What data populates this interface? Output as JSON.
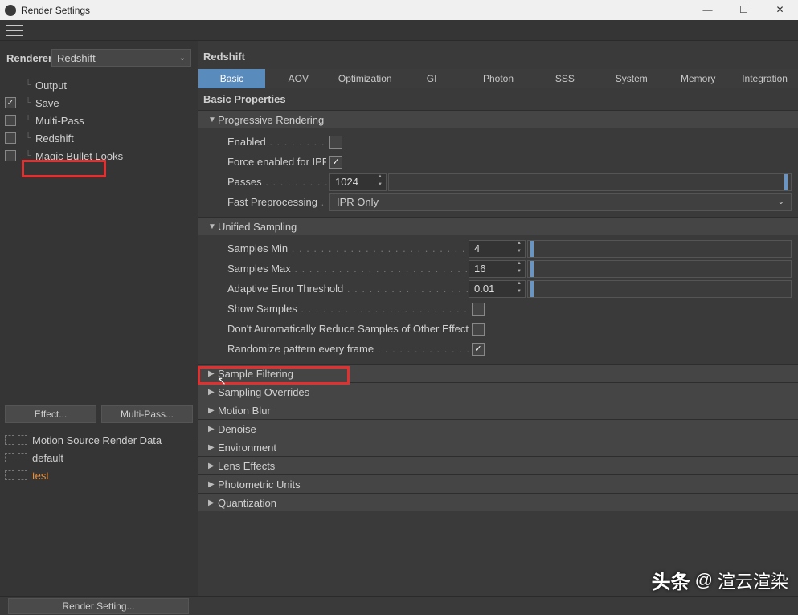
{
  "window": {
    "title": "Render Settings"
  },
  "sidebar": {
    "renderer_label": "Renderer",
    "renderer_value": "Redshift",
    "tree": [
      {
        "label": "Output",
        "checked": null
      },
      {
        "label": "Save",
        "checked": true
      },
      {
        "label": "Multi-Pass",
        "checked": false
      },
      {
        "label": "Redshift",
        "checked": false
      },
      {
        "label": "Magic Bullet Looks",
        "checked": false
      }
    ],
    "buttons": {
      "effect": "Effect...",
      "multipass": "Multi-Pass..."
    },
    "lower": [
      {
        "label": "Motion Source Render Data",
        "active": false
      },
      {
        "label": "default",
        "active": false
      },
      {
        "label": "test",
        "active": true
      }
    ]
  },
  "panel": {
    "title": "Redshift",
    "tabs": [
      "Basic",
      "AOV",
      "Optimization",
      "GI",
      "Photon",
      "SSS",
      "System",
      "Memory",
      "Integration"
    ],
    "active_tab": 0,
    "section_title": "Basic Properties",
    "groups": {
      "progressive": {
        "title": "Progressive Rendering",
        "enabled_label": "Enabled",
        "enabled": false,
        "force_label": "Force enabled for IPR",
        "force": true,
        "passes_label": "Passes",
        "passes_value": "1024",
        "fast_label": "Fast Preprocessing",
        "fast_value": "IPR Only"
      },
      "unified": {
        "title": "Unified Sampling",
        "min_label": "Samples Min",
        "min_value": "4",
        "max_label": "Samples Max",
        "max_value": "16",
        "thresh_label": "Adaptive Error Threshold",
        "thresh_value": "0.01",
        "show_label": "Show Samples",
        "show": false,
        "dont_label": "Don't Automatically Reduce Samples of Other Effects",
        "dont": false,
        "rand_label": "Randomize pattern every frame",
        "rand": true
      },
      "collapsed": [
        "Sample Filtering",
        "Sampling Overrides",
        "Motion Blur",
        "Denoise",
        "Environment",
        "Lens Effects",
        "Photometric Units",
        "Quantization"
      ]
    }
  },
  "bottom": {
    "button": "Render Setting..."
  },
  "watermark": {
    "prefix": "头条",
    "at": "@",
    "name": "渲云渲染"
  }
}
